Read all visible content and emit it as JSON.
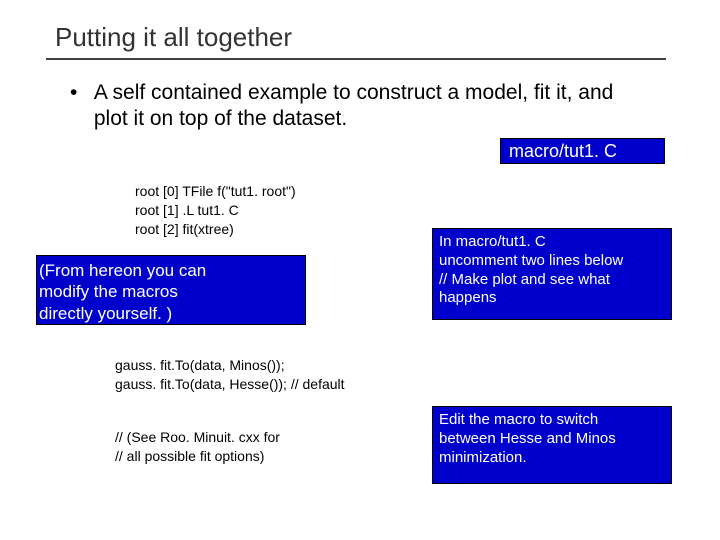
{
  "title": "Putting it all together",
  "bullet": {
    "dot": "•",
    "text": "A self contained example to construct a model, fit it, and plot it on top of the dataset."
  },
  "macro_badge": "macro/tut1. C",
  "code1": {
    "l1": "root [0] TFile f(\"tut1. root\")",
    "l2": "root [1] .L tut1. C",
    "l3": "root [2] fit(xtree)"
  },
  "note1": {
    "l1": "(From hereon you can",
    "l2": " modify the macros",
    "l3": " directly yourself. )"
  },
  "note2": {
    "l1": "In macro/tut1. C",
    "l2": "uncomment two lines below",
    "l3": "// Make plot and see what",
    "l4": "happens"
  },
  "code2": {
    "l1": "gauss. fit.To(data, Minos());",
    "l2": "gauss. fit.To(data, Hesse()); // default"
  },
  "code3": {
    "l1": "// (See Roo. Minuit. cxx for",
    "l2": "//  all possible fit options)"
  },
  "note3": {
    "l1": "Edit the macro to switch",
    "l2": "between Hesse and Minos",
    "l3": "minimization."
  }
}
